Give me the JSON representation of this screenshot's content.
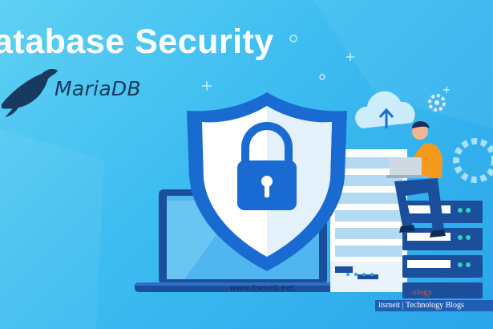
{
  "banner": {
    "title": "atabase Security",
    "logo_text": "MariaDB",
    "url": "www.itsmeit.net",
    "watermark": "itsmeit | Technology Blogs",
    "watermark_ghost": "ology"
  },
  "colors": {
    "bg_light": "#5fd0f3",
    "bg_dark": "#2aa6ea",
    "shield_outer": "#1a6bd1",
    "shield_inner": "#ffffff",
    "lock": "#1a6bd1",
    "server": "#1b4f9c",
    "person_shirt": "#f39a1e"
  },
  "icons": [
    "seal-logo-icon",
    "shield-lock-icon",
    "laptop-icon",
    "server-rack-icon",
    "cloud-upload-icon",
    "gear-icon",
    "person-with-laptop-icon"
  ]
}
